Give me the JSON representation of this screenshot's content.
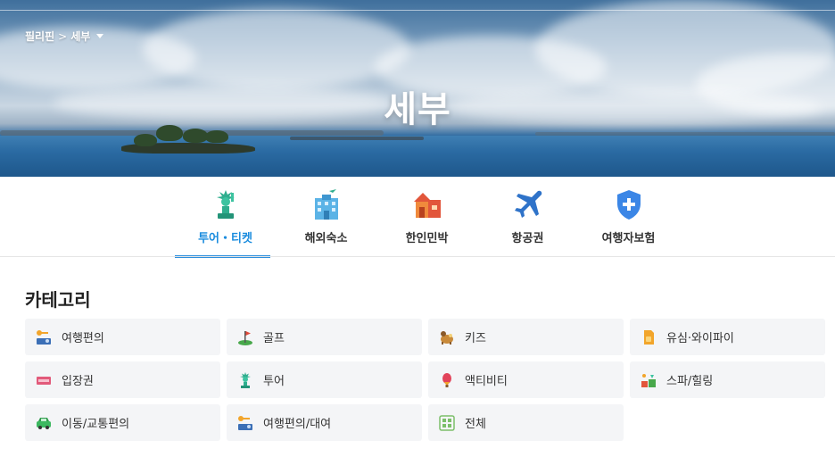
{
  "breadcrumb": {
    "country": "필리핀",
    "separator": ">",
    "city": "세부"
  },
  "hero": {
    "title": "세부"
  },
  "tabs": [
    {
      "label": "투어・티켓",
      "icon": "statue-of-liberty-icon",
      "active": true
    },
    {
      "label": "해외숙소",
      "icon": "hotel-icon",
      "active": false
    },
    {
      "label": "한인민박",
      "icon": "house-icon",
      "active": false
    },
    {
      "label": "항공권",
      "icon": "airplane-icon",
      "active": false
    },
    {
      "label": "여행자보험",
      "icon": "shield-plus-icon",
      "active": false
    }
  ],
  "category": {
    "title": "카테고리",
    "items": [
      {
        "label": "여행편의",
        "icon": "travel-kit-icon"
      },
      {
        "label": "골프",
        "icon": "golf-flag-icon"
      },
      {
        "label": "키즈",
        "icon": "kids-toy-icon"
      },
      {
        "label": "유심·와이파이",
        "icon": "sim-card-icon"
      },
      {
        "label": "입장권",
        "icon": "ticket-icon"
      },
      {
        "label": "투어",
        "icon": "statue-of-liberty-icon"
      },
      {
        "label": "액티비티",
        "icon": "hot-air-balloon-icon"
      },
      {
        "label": "스파/힐링",
        "icon": "spa-icon"
      },
      {
        "label": "이동/교통편의",
        "icon": "car-icon"
      },
      {
        "label": "여행편의/대여",
        "icon": "travel-kit-icon"
      },
      {
        "label": "전체",
        "icon": "grid-all-icon"
      }
    ]
  },
  "colors": {
    "accent": "#1b8cde",
    "cell_bg": "#f4f5f7"
  }
}
